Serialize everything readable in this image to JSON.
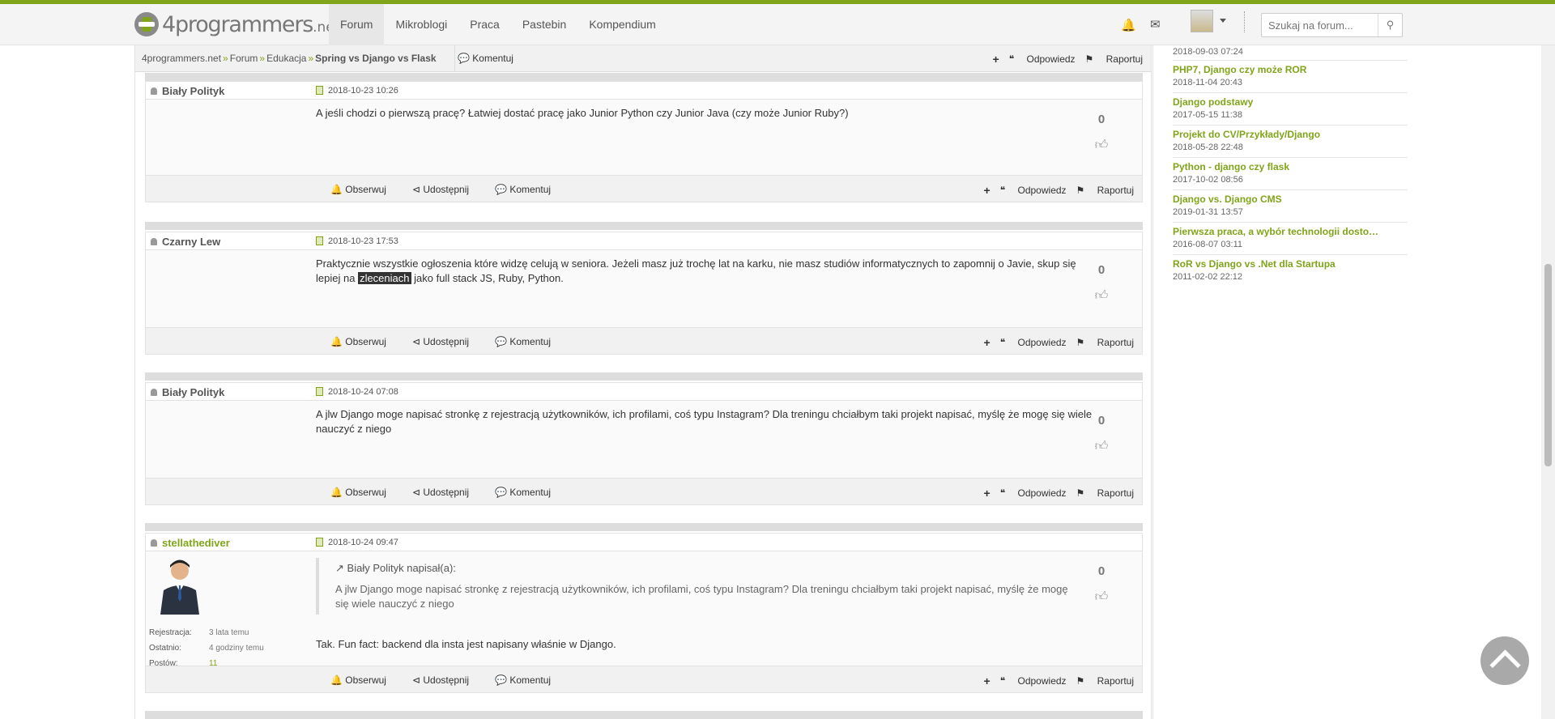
{
  "header": {
    "logo_main": "4programmers",
    "logo_tld": ".net",
    "nav": [
      "Forum",
      "Mikroblogi",
      "Praca",
      "Pastebin",
      "Kompendium"
    ],
    "search_placeholder": "Szukaj na forum..."
  },
  "breadcrumb": {
    "items": [
      "4programmers.net",
      "Forum",
      "Edukacja"
    ],
    "current": "Spring vs Django vs Flask",
    "comment": "Komentuj"
  },
  "actions": {
    "reply": "Odpowiedz",
    "report": "Raportuj",
    "follow": "Obserwuj",
    "share": "Udostępnij",
    "comment": "Komentuj"
  },
  "posts": [
    {
      "author": "Biały Polityk",
      "date": "2018-10-23 10:26",
      "body": "A jeśli chodzi o pierwszą pracę? Łatwiej dostać pracę jako Junior Python czy Junior Java (czy może Junior Ruby?)",
      "votes": "0"
    },
    {
      "author": "Czarny Lew",
      "date": "2018-10-23 17:53",
      "body_before": "Praktycznie wszystkie ogłoszenia które widzę celują w seniora. Jeżeli masz już trochę lat na karku, nie masz studiów informatycznych to zapomnij o Javie, skup się lepiej na",
      "body_highlight": "zleceniach",
      "body_after": "jako full stack JS, Ruby, Python.",
      "votes": "0"
    },
    {
      "author": "Biały Polityk",
      "date": "2018-10-24 07:08",
      "body": "A jlw Django moge napisać stronkę z rejestracją użytkowników, ich profilami, coś typu Instagram? Dla treningu chciałbym taki projekt napisać, myślę że mogę się wiele nauczyć z niego",
      "votes": "0"
    },
    {
      "author": "stellathediver",
      "date": "2018-10-24 09:47",
      "quote_head": "Biały Polityk napisał(a):",
      "quote_body": "A jlw Django moge napisać stronkę z rejestracją użytkowników, ich profilami, coś typu Instagram? Dla treningu chciałbym taki projekt napisać, myślę że mogę się wiele nauczyć z niego",
      "body": "Tak. Fun fact: backend dla insta jest napisany właśnie w Django.",
      "votes": "0",
      "meta": [
        {
          "k": "Rejestracja:",
          "v": "3 lata temu"
        },
        {
          "k": "Ostatnio:",
          "v": "4 godziny temu"
        },
        {
          "k": "Postów:",
          "v": "11"
        }
      ]
    }
  ],
  "sidebar": {
    "first_date": "2018-09-03 07:24",
    "items": [
      {
        "title": "PHP7, Django czy może ROR",
        "date": "2018-11-04 20:43"
      },
      {
        "title": "Django podstawy",
        "date": "2017-05-15 11:38"
      },
      {
        "title": "Projekt do CV/Przykłady/Django",
        "date": "2018-05-28 22:48"
      },
      {
        "title": "Python - django czy flask",
        "date": "2017-10-02 08:56"
      },
      {
        "title": "Django vs. Django CMS",
        "date": "2019-01-31 13:57"
      },
      {
        "title": "Pierwsza praca, a wybór technologii dosto…",
        "date": "2016-08-07 03:11"
      },
      {
        "title": "RoR vs Django vs .Net dla Startupa",
        "date": "2011-02-02 22:12"
      }
    ]
  },
  "colors": {
    "accent": "#80a41a",
    "bar": "#f1f1f1"
  }
}
